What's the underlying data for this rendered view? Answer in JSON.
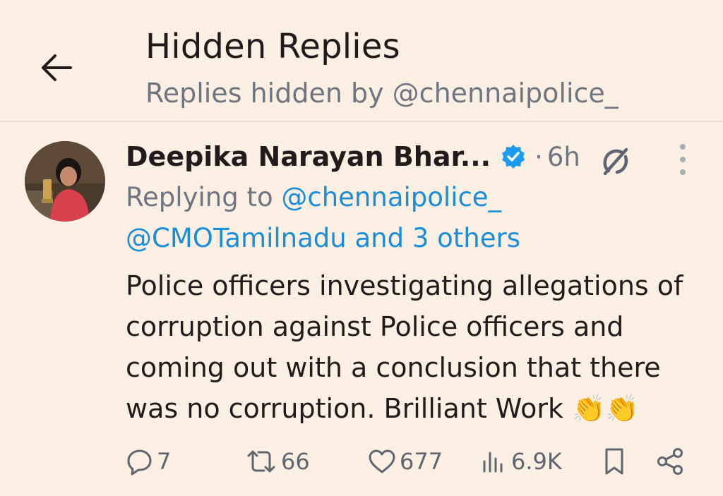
{
  "header": {
    "title": "Hidden Replies",
    "subtitle": "Replies hidden by @chennaipolice_"
  },
  "tweet": {
    "author_name": "Deepika Narayan Bhar...",
    "separator": "·",
    "time": "6h",
    "replying_prefix": "Replying to",
    "replying_handle": "@chennaipolice_",
    "replying_more": "@CMOTamilnadu and 3 others",
    "text_lines": [
      "Police officers investigating allegations of",
      "corruption against Police officers and",
      "coming out with a conclusion that there",
      "was no corruption. Brilliant Work 👏👏"
    ],
    "stats": {
      "replies": "7",
      "reposts": "66",
      "likes": "677",
      "views": "6.9K"
    }
  },
  "colors": {
    "background": "#fbefe3",
    "link": "#1a8cd8",
    "verified": "#1d9bf0",
    "muted": "#6f7580"
  },
  "icons": [
    "back-arrow-icon",
    "verified-badge-icon",
    "grok-icon",
    "more-vertical-icon",
    "reply-icon",
    "repost-icon",
    "like-icon",
    "views-icon",
    "bookmark-icon",
    "share-icon"
  ]
}
